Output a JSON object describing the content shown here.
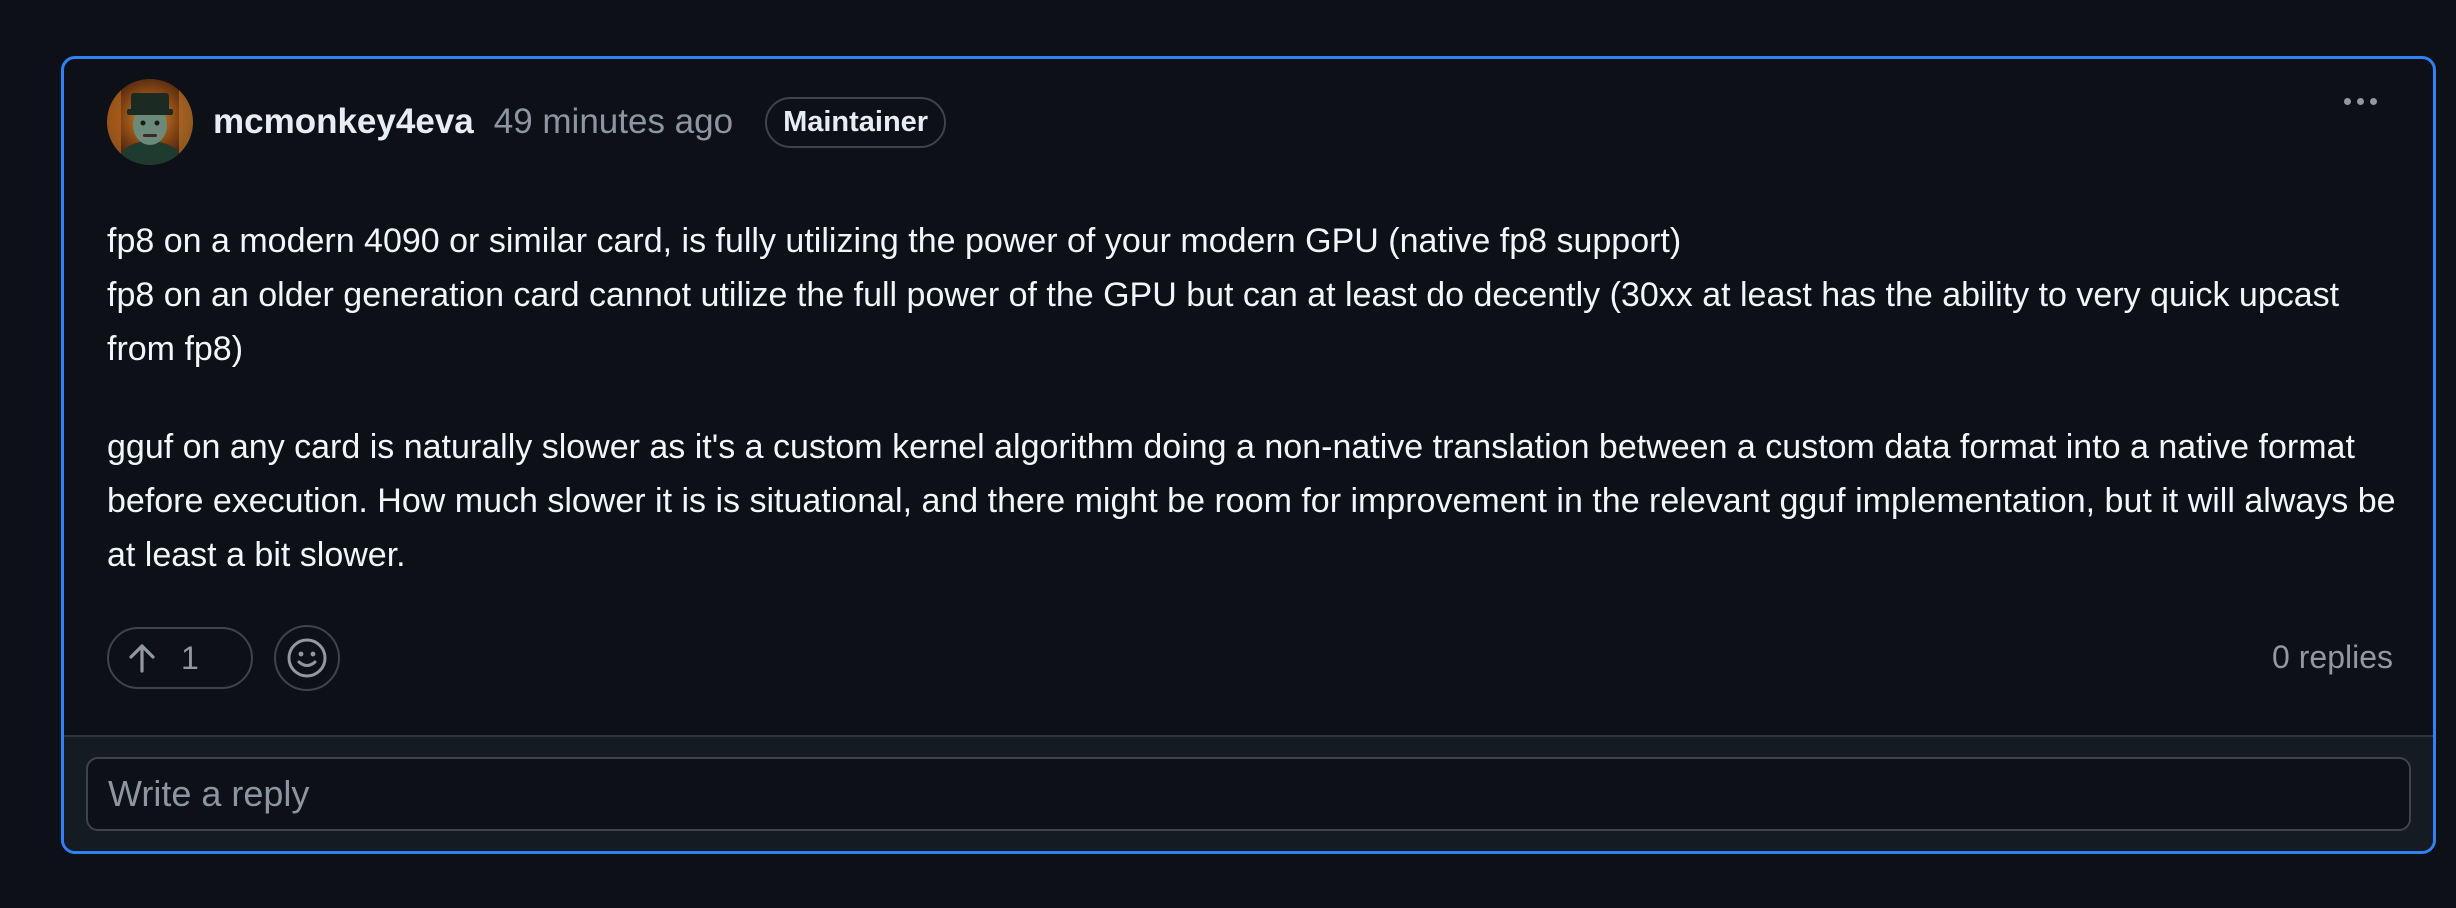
{
  "comment": {
    "author": "mcmonkey4eva",
    "timestamp": "49 minutes ago",
    "role_badge": "Maintainer",
    "body": {
      "paragraph_1": "fp8 on a modern 4090 or similar card, is fully utilizing the power of your modern GPU (native fp8 support)",
      "paragraph_1b": "fp8 on an older generation card cannot utilize the full power of the GPU but can at least do decently (30xx at least has the ability to very quick upcast from fp8)",
      "paragraph_2": "gguf on any card is naturally slower as it's a custom kernel algorithm doing a non-native translation between a custom data format into a native format before execution. How much slower it is is situational, and there might be room for improvement in the relevant gguf implementation, but it will always be at least a bit slower."
    },
    "upvote_count": "1",
    "replies_label": "0 replies"
  },
  "reply": {
    "placeholder": "Write a reply"
  },
  "icons": {
    "more": "kebab-horizontal-icon",
    "upvote": "arrow-up-icon",
    "emoji": "smiley-icon"
  },
  "colors": {
    "accent_border": "#2f81f7",
    "background": "#0d1117",
    "muted_text": "#8d96a0"
  }
}
